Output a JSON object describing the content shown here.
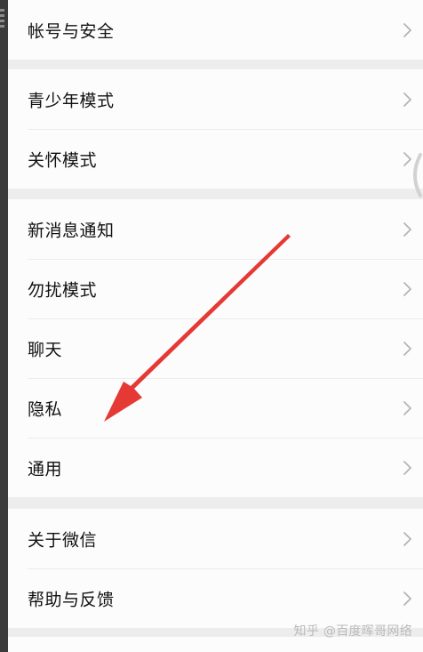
{
  "groups": [
    {
      "items": [
        {
          "label": "帐号与安全"
        }
      ]
    },
    {
      "items": [
        {
          "label": "青少年模式"
        },
        {
          "label": "关怀模式"
        }
      ]
    },
    {
      "items": [
        {
          "label": "新消息通知"
        },
        {
          "label": "勿扰模式"
        },
        {
          "label": "聊天"
        },
        {
          "label": "隐私"
        },
        {
          "label": "通用"
        }
      ]
    },
    {
      "items": [
        {
          "label": "关于微信"
        },
        {
          "label": "帮助与反馈"
        }
      ]
    }
  ],
  "annotation": {
    "arrow_color": "#e53935"
  },
  "watermark": "知乎 @百度晖哥网络"
}
